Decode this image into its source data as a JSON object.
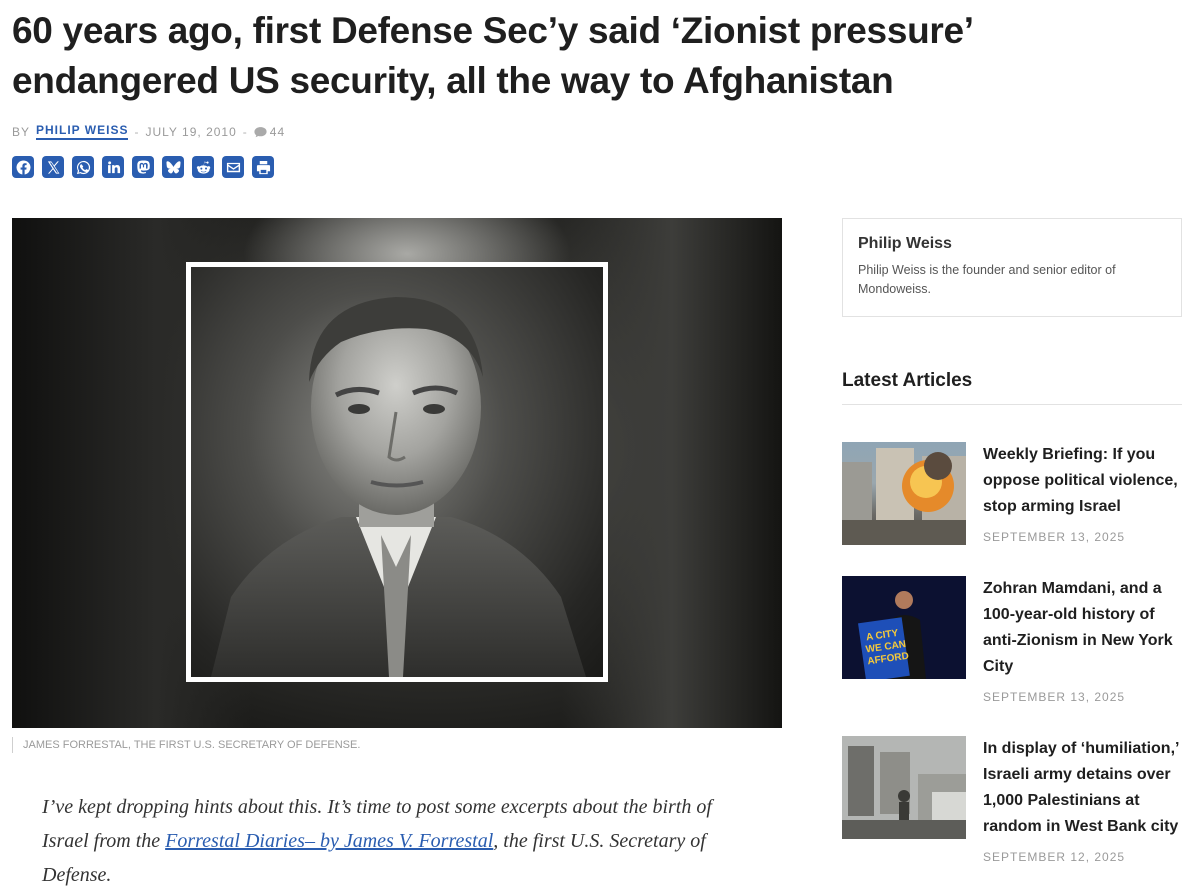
{
  "article": {
    "title": "60 years ago, first Defense Sec’y said ‘Zionist pressure’ endangered US security, all the way to Afghanistan",
    "by_label": "BY",
    "author": "PHILIP WEISS",
    "date": "JULY 19, 2010",
    "comment_count": "44",
    "share_buttons": [
      "facebook-icon",
      "x-icon",
      "whatsapp-icon",
      "linkedin-icon",
      "mastodon-icon",
      "bluesky-icon",
      "reddit-icon",
      "email-icon",
      "print-icon"
    ],
    "image_caption": "JAMES FORRESTAL, THE FIRST U.S. SECRETARY OF DEFENSE.",
    "body_intro": "I’ve kept dropping hints about this. It’s time to post some excerpts about the birth of Israel from the ",
    "body_link": "Forrestal Diaries– by James V. Forrestal",
    "body_outro": ", the first U.S. Secretary of Defense."
  },
  "sidebar": {
    "author_box": {
      "name": "Philip Weiss",
      "bio": "Philip Weiss is the founder and senior editor of Mondoweiss."
    },
    "latest_title": "Latest Articles",
    "articles": [
      {
        "title": "Weekly Briefing: If you oppose political violence, stop arming Israel",
        "date": "SEPTEMBER 13, 2025"
      },
      {
        "title": "Zohran Mamdani, and a 100-year-old history of anti-Zionism in New York City",
        "date": "SEPTEMBER 13, 2025",
        "thumb_text": "A CITY WE CAN AFFORD"
      },
      {
        "title": "In display of ‘humiliation,’ Israeli army detains over 1,000 Palestinians at random in West Bank city",
        "date": "SEPTEMBER 12, 2025"
      }
    ]
  },
  "colors": {
    "accent": "#2a5db0",
    "muted": "#9a9a9a"
  }
}
